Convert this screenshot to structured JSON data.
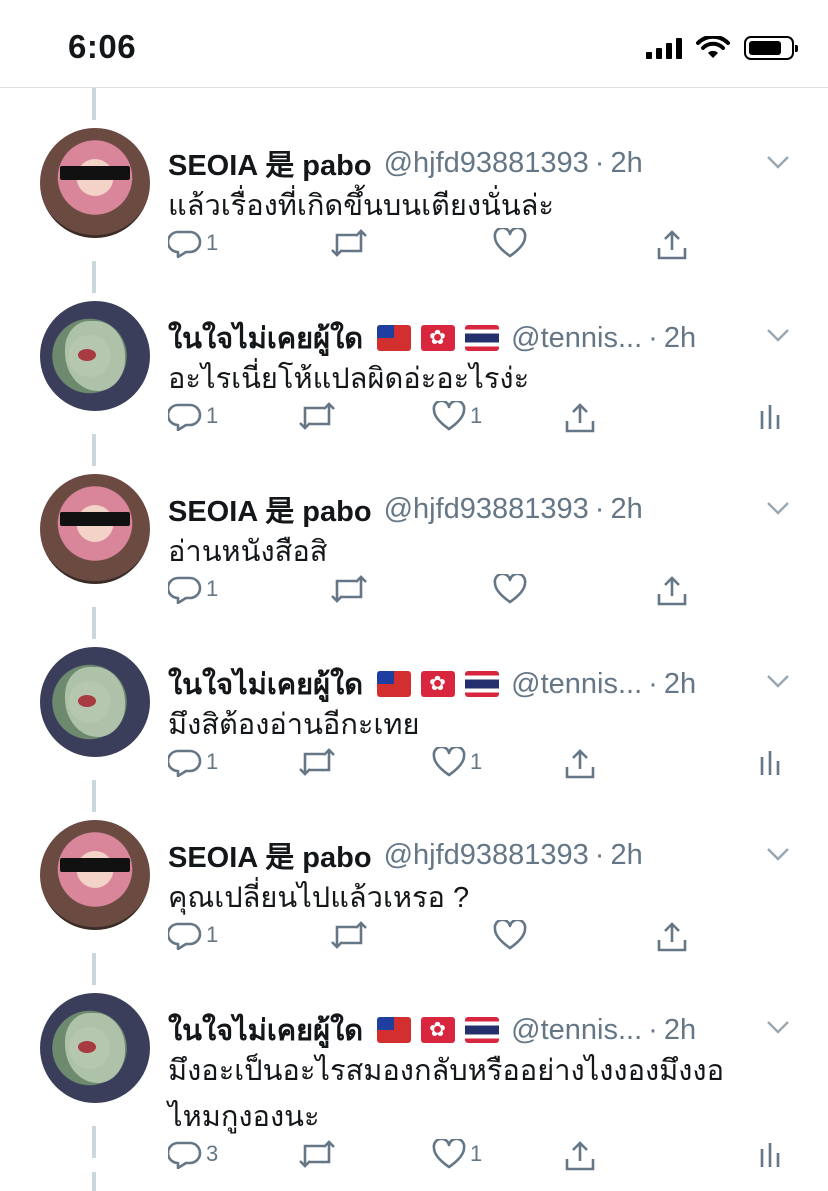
{
  "status_bar": {
    "time": "6:06"
  },
  "tweets": [
    {
      "name": "SEOIA 是 pabo",
      "handle": "@hjfd93881393",
      "sep": "·",
      "time": "2h",
      "text": "แล้วเรื่องที่เกิดขึ้นบนเตียงนั่นล่ะ",
      "reply_count": "1",
      "like_count": "",
      "has_flags": false,
      "has_analytics": false
    },
    {
      "name": "ในใจไม่เคยผู้ใด",
      "handle": "@tennis...",
      "sep": "·",
      "time": "2h",
      "text": "อะไรเนี่ยโห้แปลผิดอ่ะอะไรง่ะ",
      "reply_count": "1",
      "like_count": "1",
      "has_flags": true,
      "has_analytics": true
    },
    {
      "name": "SEOIA 是 pabo",
      "handle": "@hjfd93881393",
      "sep": "·",
      "time": "2h",
      "text": "อ่านหนังสือสิ",
      "reply_count": "1",
      "like_count": "",
      "has_flags": false,
      "has_analytics": false
    },
    {
      "name": "ในใจไม่เคยผู้ใด",
      "handle": "@tennis...",
      "sep": "·",
      "time": "2h",
      "text": "มึงสิต้องอ่านอีกะเทย",
      "reply_count": "1",
      "like_count": "1",
      "has_flags": true,
      "has_analytics": true
    },
    {
      "name": "SEOIA 是 pabo",
      "handle": "@hjfd93881393",
      "sep": "·",
      "time": "2h",
      "text": "คุณเปลี่ยนไปแล้วเหรอ ?",
      "reply_count": "1",
      "like_count": "",
      "has_flags": false,
      "has_analytics": false
    },
    {
      "name": "ในใจไม่เคยผู้ใด",
      "handle": "@tennis...",
      "sep": "·",
      "time": "2h",
      "text": "มึงอะเป็นอะไรสมองกลับหรืออย่างไงงองมึงงอ ไหมกูงองนะ",
      "reply_count": "3",
      "like_count": "1",
      "has_flags": true,
      "has_analytics": true
    }
  ],
  "icons": {
    "reply": "reply-icon",
    "retweet": "retweet-icon",
    "like": "heart-icon",
    "share": "share-icon",
    "analytics": "analytics-icon",
    "more": "chevron-down-icon"
  },
  "colors": {
    "muted": "#657786",
    "text": "#14171a",
    "divider": "#ccd6dd"
  }
}
